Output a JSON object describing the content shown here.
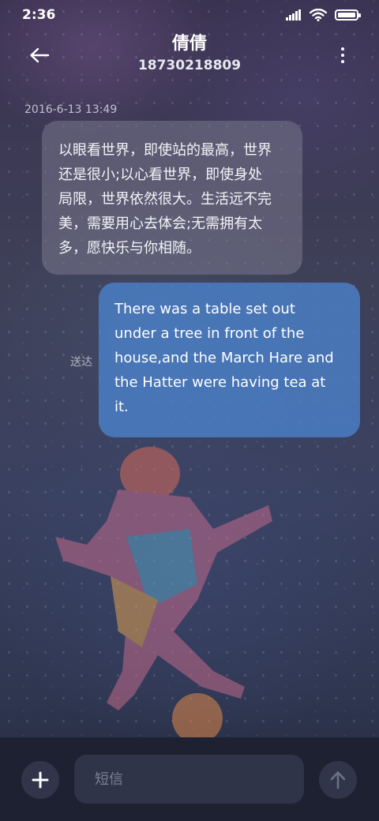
{
  "status_bar": {
    "time": "2:36",
    "icons": [
      "signal-icon",
      "wifi-icon",
      "battery-icon"
    ]
  },
  "header": {
    "contact_name": "倩倩",
    "contact_number": "18730218809",
    "back_icon": "arrow-left-icon",
    "more_icon": "more-vertical-icon"
  },
  "conversation": {
    "timestamp": "2016-6-13 13:49",
    "messages": [
      {
        "direction": "incoming",
        "lines": [
          "以眼看世界，即使站的最高，世界",
          "还是很小;以心看世界，即使身处",
          "局限，世界依然很大。生活远不完",
          "美，需要用心去体会;无需拥有太",
          "多，愿快乐与你相随。"
        ]
      },
      {
        "direction": "outgoing",
        "status": "送达",
        "lines": [
          "There was a table set out",
          "under a tree in front of the",
          "house,and the March Hare and",
          "the Hatter were having tea at",
          "it."
        ]
      }
    ]
  },
  "composer": {
    "placeholder": "短信",
    "add_icon": "plus-icon",
    "send_icon": "arrow-up-icon"
  },
  "colors": {
    "outgoing_bubble": "#4a80c8",
    "incoming_bubble": "#78768c",
    "composer_bg": "#1d2132"
  }
}
